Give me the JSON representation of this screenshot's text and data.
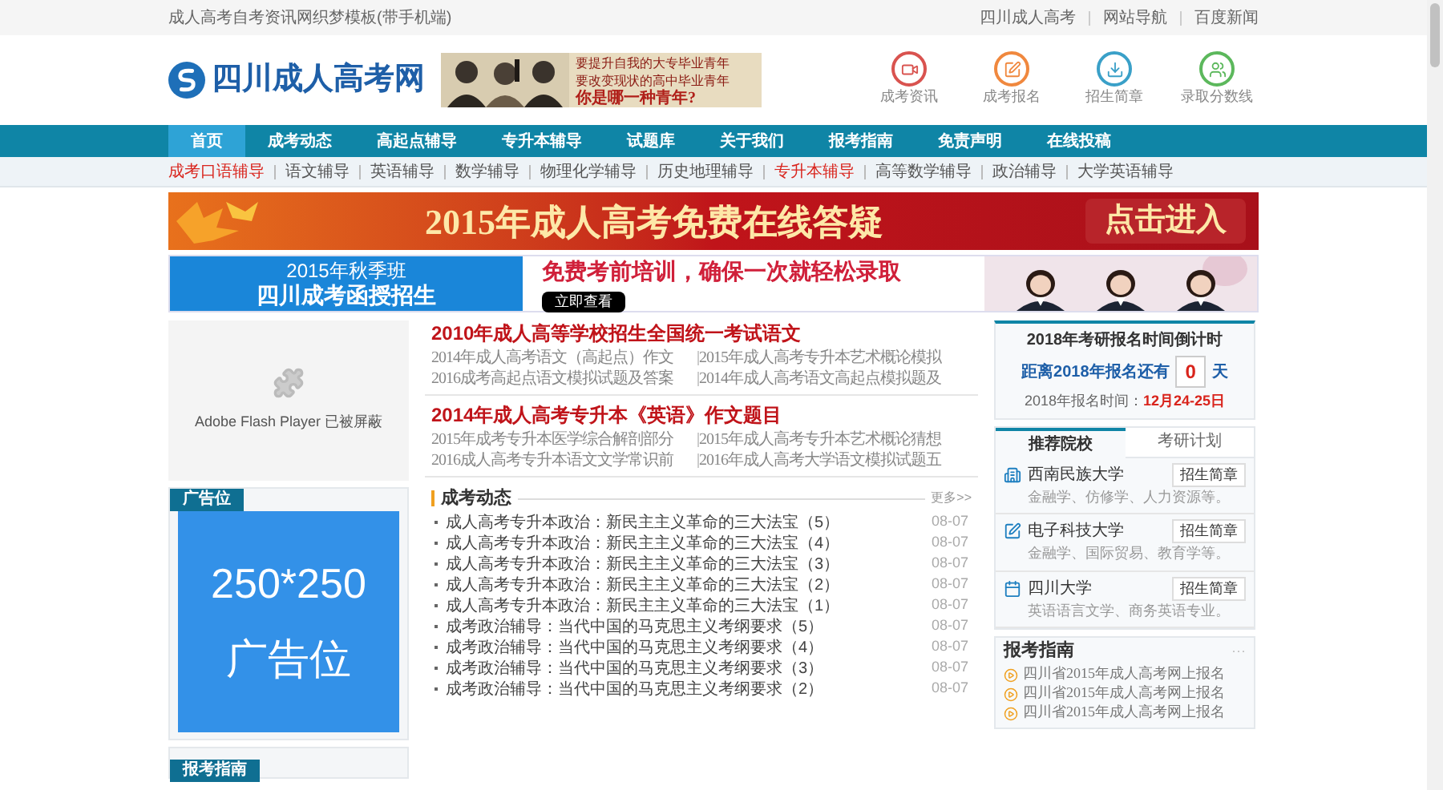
{
  "top_bar": {
    "site_title": "成人高考自考资讯网织梦模板(带手机端)",
    "links": [
      "四川成人高考",
      "网站导航",
      "百度新闻"
    ]
  },
  "header": {
    "logo_text": "四川成人高考网",
    "ad_lines": [
      "要提升自我的大专毕业青年",
      "要改变现状的高中毕业青年",
      "你是哪一种青年?"
    ],
    "shortcuts": [
      {
        "label": "成考资讯",
        "kind": "video",
        "color": "#d9534f"
      },
      {
        "label": "成考报名",
        "kind": "edit",
        "color": "#f0883e"
      },
      {
        "label": "招生简章",
        "kind": "download",
        "color": "#3aa0c8"
      },
      {
        "label": "录取分数线",
        "kind": "users",
        "color": "#5cb85c"
      }
    ]
  },
  "nav": [
    {
      "label": "首页",
      "selected": true
    },
    {
      "label": "成考动态",
      "selected": false
    },
    {
      "label": "高起点辅导",
      "selected": false
    },
    {
      "label": "专升本辅导",
      "selected": false
    },
    {
      "label": "试题库",
      "selected": false
    },
    {
      "label": "关于我们",
      "selected": false
    },
    {
      "label": "报考指南",
      "selected": false
    },
    {
      "label": "免责声明",
      "selected": false
    },
    {
      "label": "在线投稿",
      "selected": false
    }
  ],
  "subnav": [
    {
      "label": "成考口语辅导",
      "highlighted": true
    },
    {
      "label": "语文辅导",
      "highlighted": false
    },
    {
      "label": "英语辅导",
      "highlighted": false
    },
    {
      "label": "数学辅导",
      "highlighted": false
    },
    {
      "label": "物理化学辅导",
      "highlighted": false
    },
    {
      "label": "历史地理辅导",
      "highlighted": false
    },
    {
      "label": "专升本辅导",
      "highlighted": true
    },
    {
      "label": "高等数学辅导",
      "highlighted": false
    },
    {
      "label": "政治辅导",
      "highlighted": false
    },
    {
      "label": "大学英语辅导",
      "highlighted": false
    }
  ],
  "banner_qa": {
    "title": "2015年成人高考免费在线答疑",
    "button": "点击进入"
  },
  "banner_enroll": {
    "lines": [
      "2015年秋季班",
      "四川成考函授招生"
    ],
    "slogan": "免费考前培训，确保一次就轻松录取",
    "button": "立即查看"
  },
  "flash": {
    "message": "Adobe Flash Player 已被屏蔽"
  },
  "ad_block": {
    "tag": "广告位",
    "size": "250*250",
    "label": "广告位"
  },
  "next_tag": "报考指南",
  "articles": [
    {
      "headline": "2010年成人高等学校招生全国统一考试语文",
      "links": [
        "2014年成人高考语文（高起点）作文",
        "2015年成人高考专升本艺术概论模拟",
        "2016成考高起点语文模拟试题及答案",
        "2014年成人高考语文高起点模拟题及"
      ]
    },
    {
      "headline": "2014年成人高考专升本《英语》作文题目",
      "links": [
        "2015年成考专升本医学综合解剖部分",
        "2015年成人高考专升本艺术概论猜想",
        "2016成人高考专升本语文文学常识前",
        "2016年成人高考大学语文模拟试题五"
      ]
    }
  ],
  "news": {
    "title": "成考动态",
    "more": "更多>>",
    "items": [
      {
        "title": "成人高考专升本政治：新民主主义革命的三大法宝（5）",
        "date": "08-07"
      },
      {
        "title": "成人高考专升本政治：新民主主义革命的三大法宝（4）",
        "date": "08-07"
      },
      {
        "title": "成人高考专升本政治：新民主主义革命的三大法宝（3）",
        "date": "08-07"
      },
      {
        "title": "成人高考专升本政治：新民主主义革命的三大法宝（2）",
        "date": "08-07"
      },
      {
        "title": "成人高考专升本政治：新民主主义革命的三大法宝（1）",
        "date": "08-07"
      },
      {
        "title": "成考政治辅导：当代中国的马克思主义考纲要求（5）",
        "date": "08-07"
      },
      {
        "title": "成考政治辅导：当代中国的马克思主义考纲要求（4）",
        "date": "08-07"
      },
      {
        "title": "成考政治辅导：当代中国的马克思主义考纲要求（3）",
        "date": "08-07"
      },
      {
        "title": "成考政治辅导：当代中国的马克思主义考纲要求（2）",
        "date": "08-07"
      }
    ]
  },
  "countdown": {
    "title": "2018年考研报名时间倒计时",
    "prefix": "距离2018年报名还有",
    "days": "0",
    "suffix": "天",
    "date_label": "2018年报名时间：",
    "date_value": "12月24-25日"
  },
  "schools": {
    "tabs": [
      {
        "label": "推荐院校",
        "selected": true
      },
      {
        "label": "考研计划",
        "selected": false
      }
    ],
    "items": [
      {
        "name": "西南民族大学",
        "kind": "building",
        "button": "招生简章",
        "majors": "金融学、仿修学、人力资源等。"
      },
      {
        "name": "电子科技大学",
        "kind": "edit",
        "button": "招生简章",
        "majors": "金融学、国际贸易、教育学等。"
      },
      {
        "name": "四川大学",
        "kind": "calendar",
        "button": "招生简章",
        "majors": "英语语言文学、商务英语专业。"
      }
    ]
  },
  "guide": {
    "title": "报考指南",
    "more": "···",
    "items": [
      "四川省2015年成人高考网上报名",
      "四川省2015年成人高考网上报名",
      "四川省2015年成人高考网上报名"
    ]
  }
}
